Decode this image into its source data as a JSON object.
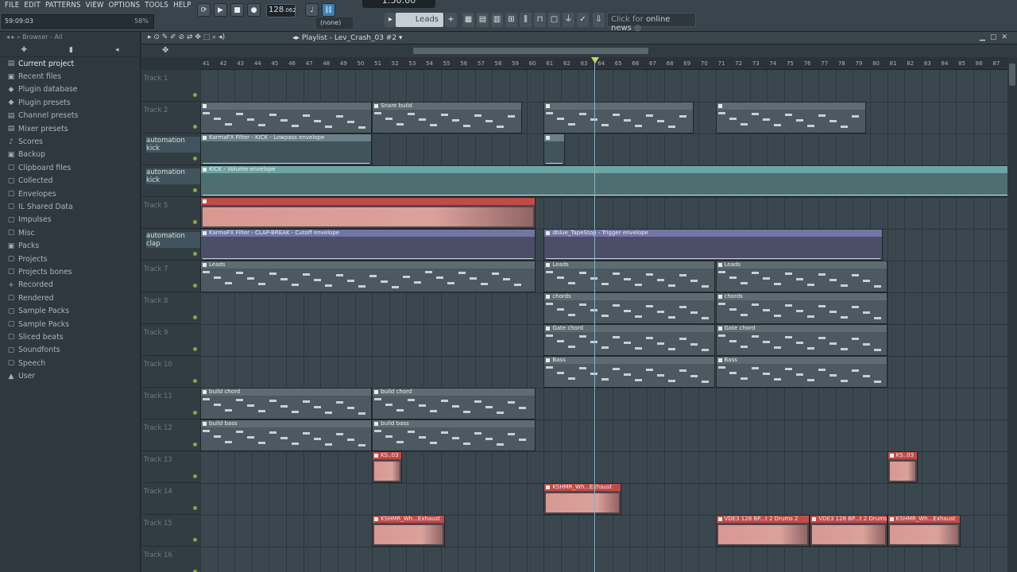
{
  "menu": [
    "FILE",
    "EDIT",
    "PATTERNS",
    "VIEW",
    "OPTIONS",
    "TOOLS",
    "HELP"
  ],
  "hint": {
    "time": "59:09:03",
    "percent": "58%"
  },
  "transport": {
    "tempo": "128",
    "tempo_frac": ".062",
    "time": "1:50:00",
    "pattern_none": "(none)",
    "pattern_selector": "Leads",
    "news": "Click for ",
    "news_bold": "online news"
  },
  "browser": {
    "header": "Browser - All",
    "items": [
      {
        "label": "Current project",
        "icon": "▤",
        "active": true
      },
      {
        "label": "Recent files",
        "icon": "▣"
      },
      {
        "label": "Plugin database",
        "icon": "◆"
      },
      {
        "label": "Plugin presets",
        "icon": "◆"
      },
      {
        "label": "Channel presets",
        "icon": "▤"
      },
      {
        "label": "Mixer presets",
        "icon": "▤"
      },
      {
        "label": "Scores",
        "icon": "♪"
      },
      {
        "label": "Backup",
        "icon": "▣"
      },
      {
        "label": "Clipboard files",
        "icon": "▢"
      },
      {
        "label": "Collected",
        "icon": "▢"
      },
      {
        "label": "Envelopes",
        "icon": "▢"
      },
      {
        "label": "IL Shared Data",
        "icon": "▢"
      },
      {
        "label": "Impulses",
        "icon": "▢"
      },
      {
        "label": "Misc",
        "icon": "▢"
      },
      {
        "label": "Packs",
        "icon": "▣"
      },
      {
        "label": "Projects",
        "icon": "▢"
      },
      {
        "label": "Projects bones",
        "icon": "▢"
      },
      {
        "label": "Recorded",
        "icon": "+"
      },
      {
        "label": "Rendered",
        "icon": "▢"
      },
      {
        "label": "Sample Packs",
        "icon": "▢"
      },
      {
        "label": "Sample Packs",
        "icon": "▢"
      },
      {
        "label": "Sliced beats",
        "icon": "▢"
      },
      {
        "label": "Soundfonts",
        "icon": "▢"
      },
      {
        "label": "Speech",
        "icon": "▢"
      },
      {
        "label": "User",
        "icon": "▲"
      }
    ]
  },
  "playlist": {
    "title": "Playlist - Lev_Crash_03 #2",
    "ruler": [
      "41",
      "42",
      "43",
      "44",
      "45",
      "46",
      "47",
      "48",
      "49",
      "50",
      "51",
      "52",
      "53",
      "54",
      "55",
      "56",
      "57",
      "58",
      "59",
      "60",
      "61",
      "62",
      "63",
      "64",
      "65",
      "66",
      "67",
      "68",
      "69",
      "70",
      "71",
      "72",
      "73",
      "74",
      "75",
      "76",
      "77",
      "78",
      "79",
      "80",
      "81",
      "82",
      "83",
      "84",
      "85",
      "86",
      "87"
    ],
    "tracks": [
      {
        "name": "Track 1",
        "auto": false
      },
      {
        "name": "Track 2",
        "auto": false
      },
      {
        "name": "automation kick",
        "auto": true
      },
      {
        "name": "automation kick",
        "auto": true
      },
      {
        "name": "Track 5",
        "auto": false
      },
      {
        "name": "automation clap",
        "auto": true
      },
      {
        "name": "Track 7",
        "auto": false
      },
      {
        "name": "Track 8",
        "auto": false
      },
      {
        "name": "Track 9",
        "auto": false
      },
      {
        "name": "Track 10",
        "auto": false
      },
      {
        "name": "Track 11",
        "auto": false
      },
      {
        "name": "Track 12",
        "auto": false
      },
      {
        "name": "Track 13",
        "auto": false
      },
      {
        "name": "Track 14",
        "auto": false
      },
      {
        "name": "Track 15",
        "auto": false
      },
      {
        "name": "Track 16",
        "auto": false
      }
    ],
    "clips": [
      {
        "row": 1,
        "beat_start": 0,
        "beat_len": 40,
        "label": "",
        "type": "pat"
      },
      {
        "row": 1,
        "beat_start": 40,
        "beat_len": 35,
        "label": "Snare build",
        "type": "pat"
      },
      {
        "row": 1,
        "beat_start": 80,
        "beat_len": 35,
        "label": "",
        "type": "pat"
      },
      {
        "row": 1,
        "beat_start": 120,
        "beat_len": 35,
        "label": "",
        "type": "pat"
      },
      {
        "row": 2,
        "beat_start": 0,
        "beat_len": 40,
        "label": "KarmaFX Filter - KICK - Lowpass envelope",
        "type": "auto"
      },
      {
        "row": 2,
        "beat_start": 80,
        "beat_len": 5,
        "label": "",
        "type": "auto"
      },
      {
        "row": 3,
        "beat_start": 0,
        "beat_len": 236,
        "label": "KICK - Volume envelope",
        "type": "autoT"
      },
      {
        "row": 4,
        "beat_start": 0,
        "beat_len": 78,
        "label": "",
        "type": "aud"
      },
      {
        "row": 5,
        "beat_start": 0,
        "beat_len": 78,
        "label": "KarmaFX Filter - CLAP-BREAK - Cutoff envelope",
        "type": "autoP"
      },
      {
        "row": 5,
        "beat_start": 80,
        "beat_len": 79,
        "label": "dblue_TapeStop - Trigger envelope",
        "type": "autoP"
      },
      {
        "row": 6,
        "beat_start": 0,
        "beat_len": 78,
        "label": "Leads",
        "type": "pat"
      },
      {
        "row": 6,
        "beat_start": 80,
        "beat_len": 40,
        "label": "Leads",
        "type": "pat"
      },
      {
        "row": 6,
        "beat_start": 120,
        "beat_len": 40,
        "label": "Leads",
        "type": "pat"
      },
      {
        "row": 7,
        "beat_start": 80,
        "beat_len": 40,
        "label": "chords",
        "type": "pat"
      },
      {
        "row": 7,
        "beat_start": 120,
        "beat_len": 40,
        "label": "chords",
        "type": "pat"
      },
      {
        "row": 8,
        "beat_start": 80,
        "beat_len": 40,
        "label": "Gate chord",
        "type": "pat"
      },
      {
        "row": 8,
        "beat_start": 120,
        "beat_len": 40,
        "label": "Gate chord",
        "type": "pat"
      },
      {
        "row": 9,
        "beat_start": 80,
        "beat_len": 40,
        "label": "Bass",
        "type": "pat"
      },
      {
        "row": 9,
        "beat_start": 120,
        "beat_len": 40,
        "label": "Bass",
        "type": "pat"
      },
      {
        "row": 10,
        "beat_start": 0,
        "beat_len": 40,
        "label": "build chord",
        "type": "pat"
      },
      {
        "row": 10,
        "beat_start": 40,
        "beat_len": 38,
        "label": "build chord",
        "type": "pat"
      },
      {
        "row": 11,
        "beat_start": 0,
        "beat_len": 40,
        "label": "build bass",
        "type": "pat"
      },
      {
        "row": 11,
        "beat_start": 40,
        "beat_len": 38,
        "label": "build bass",
        "type": "pat"
      },
      {
        "row": 12,
        "beat_start": 40,
        "beat_len": 7,
        "label": "KS..03",
        "type": "aud"
      },
      {
        "row": 12,
        "beat_start": 160,
        "beat_len": 7,
        "label": "KS..03",
        "type": "aud"
      },
      {
        "row": 13,
        "beat_start": 80,
        "beat_len": 18,
        "label": "KSHMR_Wh...Exhaust",
        "type": "aud"
      },
      {
        "row": 14,
        "beat_start": 40,
        "beat_len": 17,
        "label": "KSHMR_Wh...Exhaust",
        "type": "aud"
      },
      {
        "row": 14,
        "beat_start": 120,
        "beat_len": 22,
        "label": "VDE3 128 BP...t 2 Drums 2",
        "type": "aud"
      },
      {
        "row": 14,
        "beat_start": 142,
        "beat_len": 18,
        "label": "VDE3 128 BP...t 2 Drums 2",
        "type": "aud"
      },
      {
        "row": 14,
        "beat_start": 160,
        "beat_len": 17,
        "label": "KSHMR_Wh...Exhaust",
        "type": "aud"
      }
    ]
  },
  "colors": {
    "accent": "#c24b47",
    "playhead": "#8ab0c0",
    "pattern": "#5f6b73"
  }
}
